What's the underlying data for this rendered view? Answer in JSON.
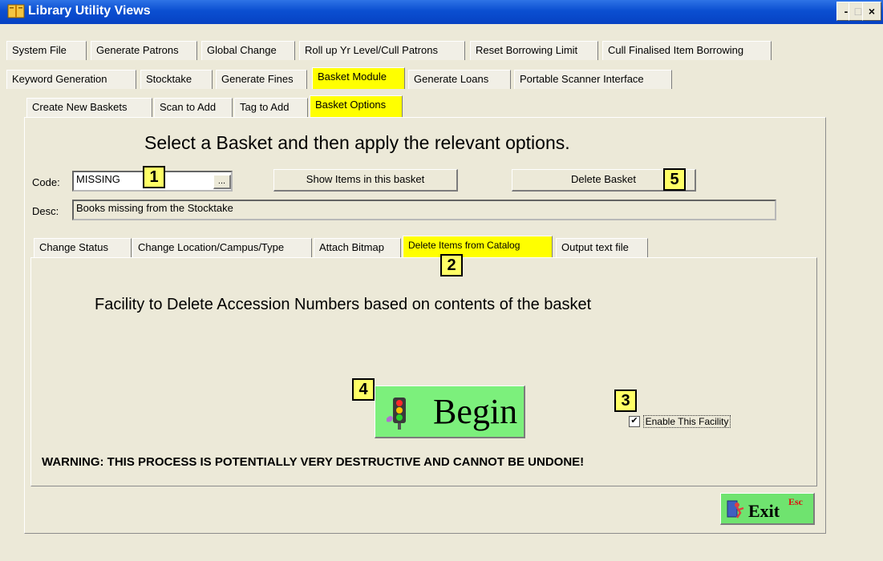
{
  "window": {
    "title": "Library Utility Views",
    "controls": {
      "minimize": "-",
      "maximize": "□",
      "close": "×"
    }
  },
  "top_tabs": {
    "row1": [
      "System File",
      "Generate Patrons",
      "Global Change",
      "Roll up Yr Level/Cull Patrons",
      "Reset Borrowing Limit",
      "Cull Finalised Item Borrowing"
    ],
    "row2": [
      "Keyword Generation",
      "Stocktake",
      "Generate Fines",
      "Basket Module",
      "Generate Loans",
      "Portable Scanner Interface"
    ],
    "selected": "Basket Module"
  },
  "basket_tabs": {
    "items": [
      "Create New Baskets",
      "Scan to Add",
      "Tag to Add",
      "Basket Options"
    ],
    "selected": "Basket Options"
  },
  "basket": {
    "heading": "Select a Basket and then apply the relevant options.",
    "code_label": "Code:",
    "code_value": "MISSING",
    "browse_label": "...",
    "show_items_label": "Show Items in this basket",
    "delete_basket_label": "Delete Basket",
    "desc_label": "Desc:",
    "desc_value": "Books missing from the Stocktake"
  },
  "option_tabs": {
    "items": [
      "Change Status",
      "Change Location/Campus/Type",
      "Attach Bitmap",
      "Delete Items from Catalog",
      "Output text file"
    ],
    "selected": "Delete Items from Catalog"
  },
  "delete_panel": {
    "heading": "Facility to Delete Accession Numbers based on contents of the basket",
    "begin_label": "Begin",
    "enable_label": "Enable This Facility",
    "enable_checked": true,
    "warning": "WARNING: THIS PROCESS IS POTENTIALLY VERY DESTRUCTIVE AND CANNOT BE UNDONE!"
  },
  "exit": {
    "label": "Exit",
    "shortcut": "Esc"
  },
  "markers": {
    "m1": "1",
    "m2": "2",
    "m3": "3",
    "m4": "4",
    "m5": "5"
  },
  "colors": {
    "highlight": "#ffff00",
    "begin_bg": "#7cf07c",
    "titlebar": "#0b4fd1",
    "exit_bg": "#6fe36f",
    "marker_bg": "#ffff66"
  },
  "icons": [
    "book-icon",
    "traffic-light-icon",
    "exit-door-icon",
    "checkbox-checked-icon"
  ]
}
